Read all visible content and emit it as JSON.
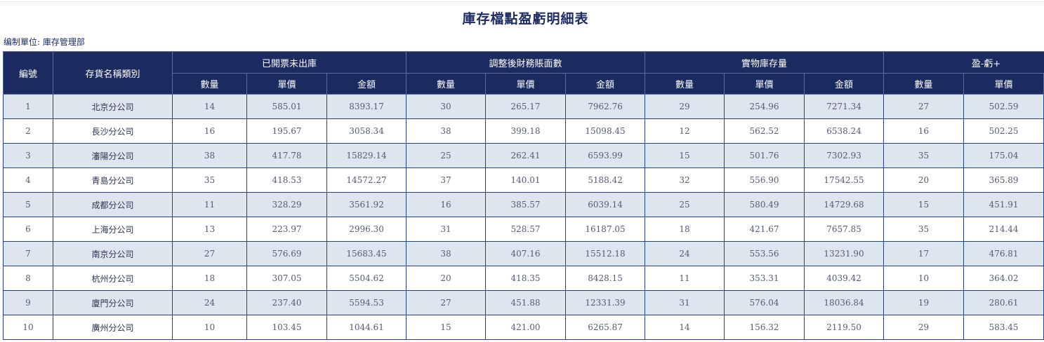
{
  "title": "庫存檔點盈虧明細表",
  "unit_label": "编制單位: 庫存管理部",
  "header": {
    "id": "編號",
    "name": "存貨名稱類別",
    "groups": [
      "已開票未出庫",
      "調整後財務賬面數",
      "實物庫存量",
      "盈-虧+"
    ],
    "sub": [
      "數量",
      "單價",
      "金額"
    ]
  },
  "rows": [
    {
      "id": "1",
      "name": "北京分公司",
      "a": [
        "14",
        "585.01",
        "8393.17"
      ],
      "b": [
        "30",
        "265.17",
        "7962.76"
      ],
      "c": [
        "29",
        "254.96",
        "7271.34"
      ],
      "d": [
        "27",
        "502.59"
      ]
    },
    {
      "id": "2",
      "name": "長沙分公司",
      "a": [
        "16",
        "195.67",
        "3058.34"
      ],
      "b": [
        "38",
        "399.18",
        "15098.45"
      ],
      "c": [
        "12",
        "562.52",
        "6538.24"
      ],
      "d": [
        "16",
        "502.25"
      ]
    },
    {
      "id": "3",
      "name": "瀋陽分公司",
      "a": [
        "38",
        "417.78",
        "15829.14"
      ],
      "b": [
        "25",
        "262.41",
        "6593.99"
      ],
      "c": [
        "15",
        "501.76",
        "7302.93"
      ],
      "d": [
        "35",
        "175.04"
      ]
    },
    {
      "id": "4",
      "name": "青島分公司",
      "a": [
        "35",
        "418.53",
        "14572.27"
      ],
      "b": [
        "37",
        "140.01",
        "5188.42"
      ],
      "c": [
        "32",
        "556.90",
        "17542.55"
      ],
      "d": [
        "20",
        "365.89"
      ]
    },
    {
      "id": "5",
      "name": "成都分公司",
      "a": [
        "11",
        "328.29",
        "3561.92"
      ],
      "b": [
        "16",
        "385.57",
        "6039.14"
      ],
      "c": [
        "25",
        "580.49",
        "14729.68"
      ],
      "d": [
        "15",
        "451.91"
      ]
    },
    {
      "id": "6",
      "name": "上海分公司",
      "a": [
        "13",
        "223.97",
        "2996.30"
      ],
      "b": [
        "31",
        "528.57",
        "16187.05"
      ],
      "c": [
        "18",
        "421.67",
        "7657.85"
      ],
      "d": [
        "35",
        "214.44"
      ]
    },
    {
      "id": "7",
      "name": "南京分公司",
      "a": [
        "27",
        "576.69",
        "15683.45"
      ],
      "b": [
        "38",
        "407.16",
        "15512.18"
      ],
      "c": [
        "24",
        "553.56",
        "13231.90"
      ],
      "d": [
        "17",
        "476.81"
      ]
    },
    {
      "id": "8",
      "name": "杭州分公司",
      "a": [
        "18",
        "307.05",
        "5504.62"
      ],
      "b": [
        "20",
        "418.35",
        "8428.15"
      ],
      "c": [
        "11",
        "353.31",
        "4039.42"
      ],
      "d": [
        "10",
        "364.02"
      ]
    },
    {
      "id": "9",
      "name": "廈門分公司",
      "a": [
        "24",
        "237.40",
        "5594.53"
      ],
      "b": [
        "27",
        "451.88",
        "12331.39"
      ],
      "c": [
        "31",
        "576.04",
        "18036.84"
      ],
      "d": [
        "19",
        "280.61"
      ]
    },
    {
      "id": "10",
      "name": "廣州分公司",
      "a": [
        "10",
        "103.45",
        "1044.61"
      ],
      "b": [
        "15",
        "421.00",
        "6265.87"
      ],
      "c": [
        "14",
        "156.32",
        "2119.50"
      ],
      "d": [
        "29",
        "583.45"
      ]
    }
  ]
}
